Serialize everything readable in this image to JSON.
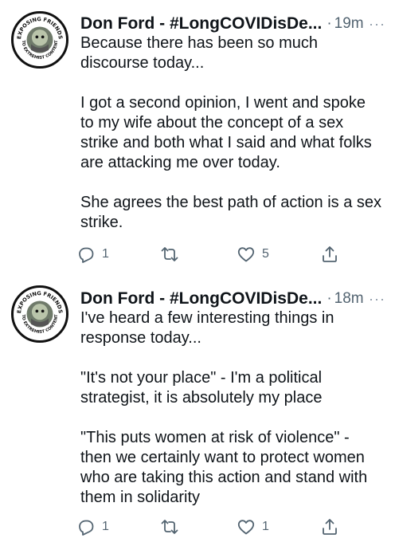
{
  "tweets": [
    {
      "display_name": "Don Ford - #LongCOVIDisDe...",
      "separator": "·",
      "time": "19m",
      "more": "···",
      "paragraphs": [
        "Because there has been so much\ndiscourse today...",
        "I got a second opinion, I went and spoke\nto my wife about the concept of a sex\nstrike and both what I said and what folks\nare attacking me over today.",
        "She agrees the best path of action is a sex\nstrike."
      ],
      "replies": "1",
      "retweets": "",
      "likes": "5"
    },
    {
      "display_name": "Don Ford - #LongCOVIDisDe...",
      "separator": "·",
      "time": "18m",
      "more": "···",
      "paragraphs": [
        "I've heard a few interesting things in\nresponse today...",
        "\"It's not your place\" - I'm a political\nstrategist, it is absolutely my place",
        "\"This puts women at risk of violence\" -\nthen we certainly want to protect women\nwho are taking this action and stand with\nthem in solidarity"
      ],
      "replies": "1",
      "retweets": "",
      "likes": "1"
    }
  ],
  "avatar": {
    "ring_text_top": "EXPOSING FRIENDS",
    "ring_text_bottom": "TO EXTREMIST CONTENT"
  },
  "icons": {
    "reply": "reply-icon",
    "retweet": "retweet-icon",
    "like": "like-icon",
    "share": "share-icon"
  }
}
